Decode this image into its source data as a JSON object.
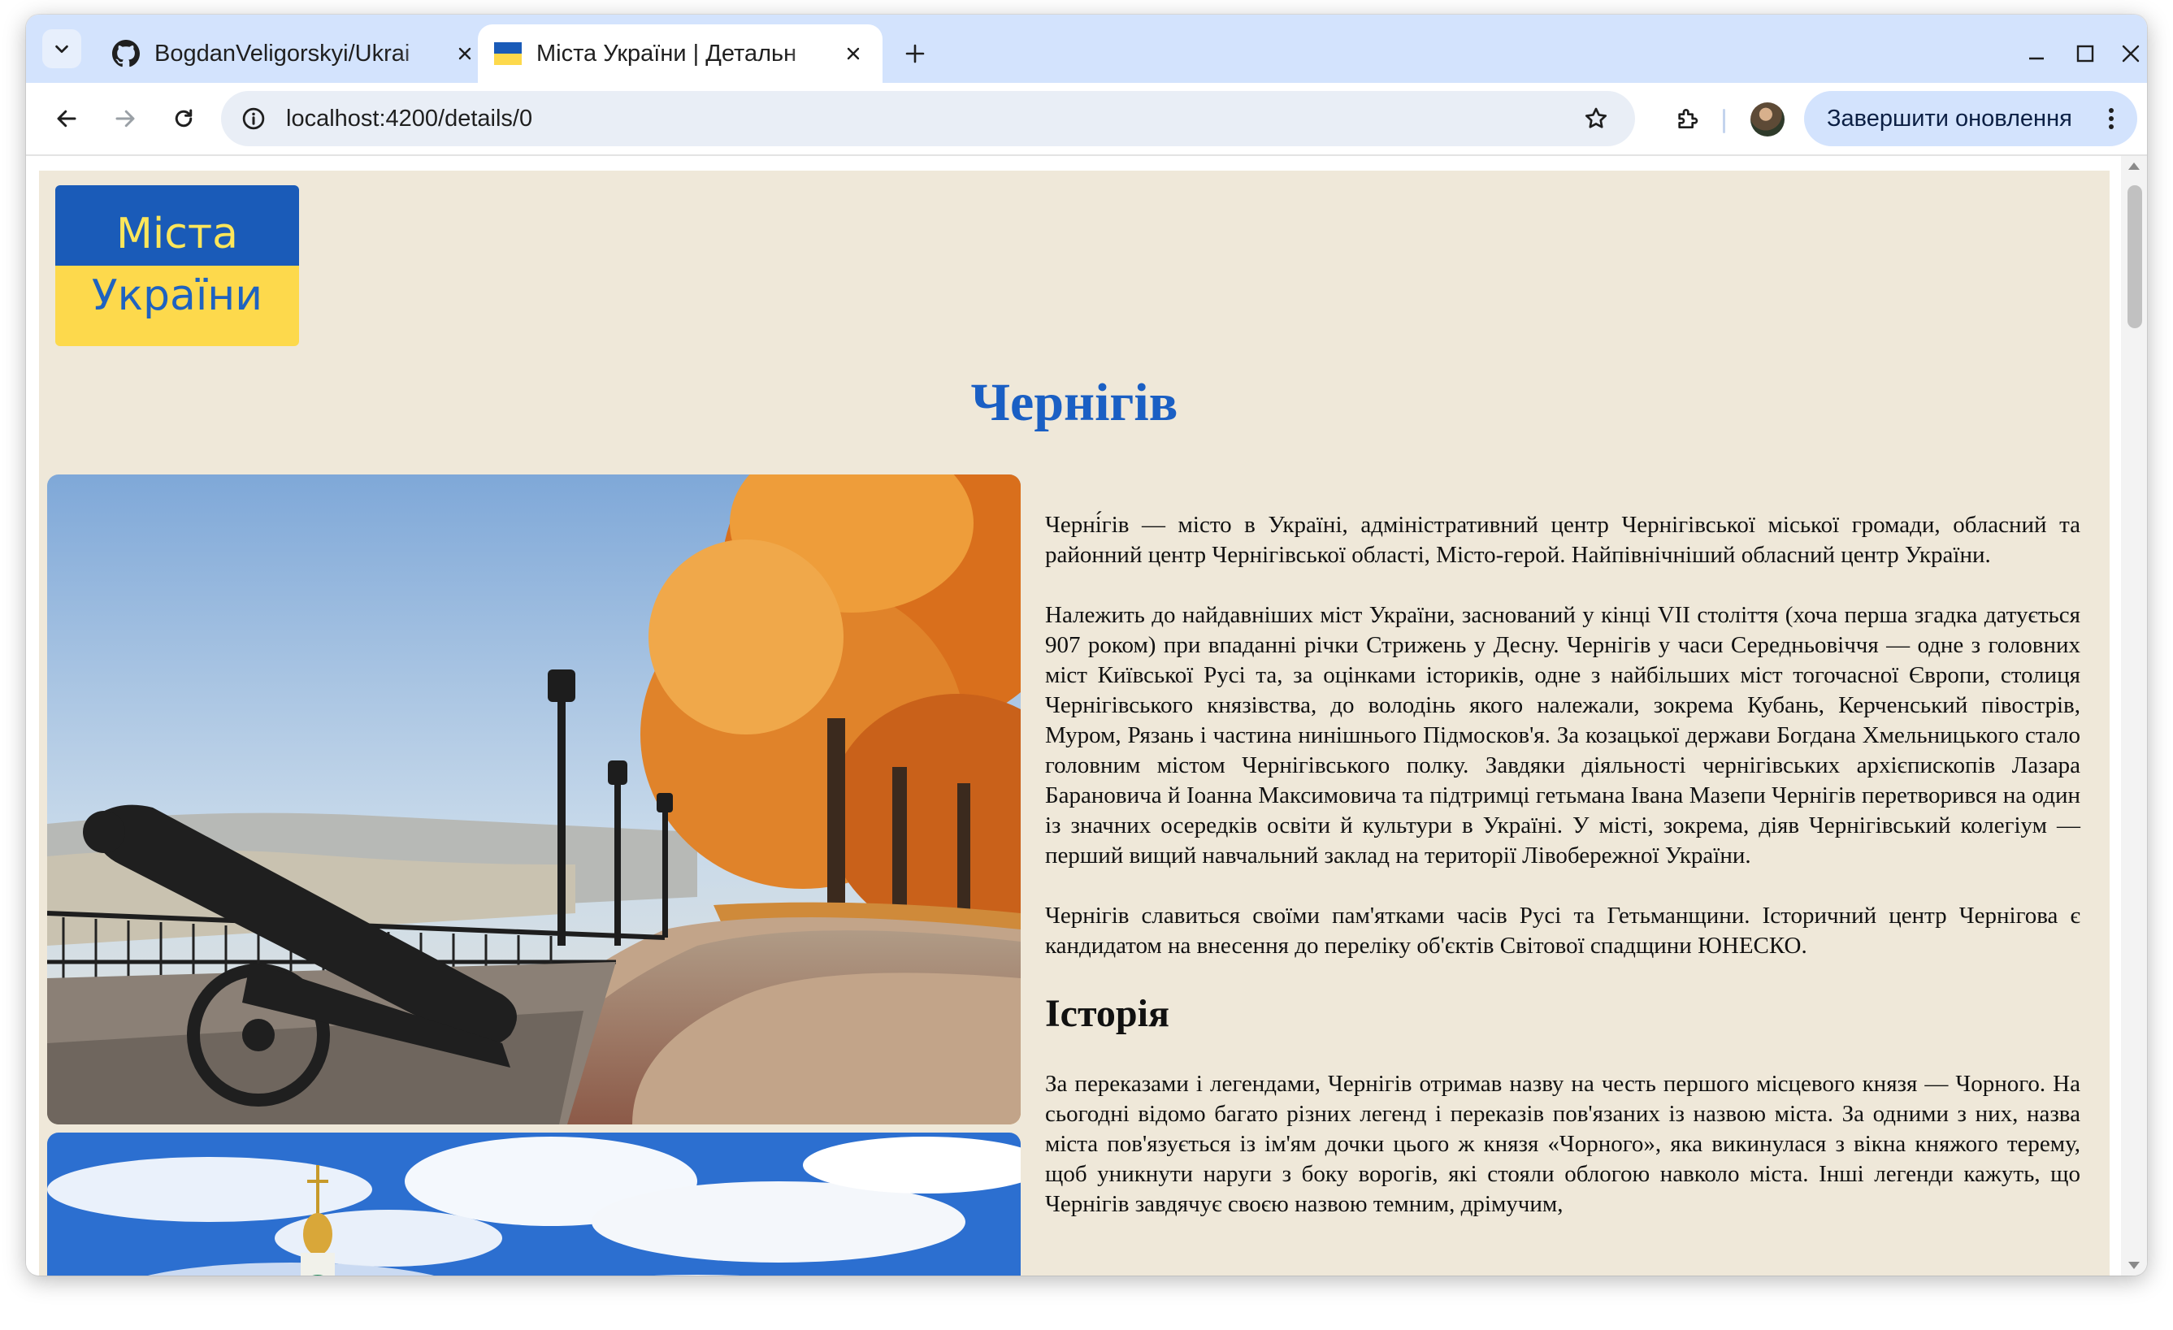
{
  "browser": {
    "tabs": [
      {
        "title": "BogdanVeligorskyi/Ukrai",
        "icon": "github-icon"
      },
      {
        "title": "Міста України | Детальн",
        "icon": "ukraine-flag-icon"
      }
    ],
    "url": "localhost:4200/details/0",
    "update_button_label": "Завершити оновлення"
  },
  "page": {
    "logo": {
      "line1": "Міста",
      "line2": "України"
    },
    "city_title": "Чернігів",
    "paragraphs": [
      "Черні́гів — місто в Україні, адміністративний центр Чернігівської міської громади, обласний та районний центр Чернігівської області, Місто-герой. Найпівнічніший обласний центр України.",
      "Належить до найдавніших міст України, заснований у кінці VII століття (хоча перша згадка датується 907 роком) при впаданні річки Стрижень у Десну. Чернігів у часи Середньовіччя — одне з головних міст Київської Русі та, за оцінками істориків, одне з найбільших міст тогочасної Європи, столиця Чернігівського князівства, до володінь якого належали, зокрема Кубань, Керченський півострів, Муром, Рязань і частина нинішнього Підмосков'я. За козацької держави Богдана Хмельницького стало головним містом Чернігівського полку. Завдяки діяльності чернігівських архієпископів Лазара Барановича й Іоанна Максимовича та підтримці гетьмана Івана Мазепи Чернігів перетворився на один із значних осередків освіти й культури в Україні. У місті, зокрема, діяв Чернігівський колегіум — перший вищий навчальний заклад на території Лівобережної України.",
      "Чернігів славиться своїми пам'ятками часів Русі та Гетьманщини. Історичний центр Чернігова є кандидатом на внесення до переліку об'єктів Світової спадщини ЮНЕСКО."
    ],
    "history_heading": "Історія",
    "history_paragraph": "За переказами і легендами, Чернігів отримав назву на честь першого місцевого князя — Чорного. На сьогодні відомо багато різних легенд і переказів пов'язаних із назвою міста. За одними з них, назва міста пов'язується із ім'ям дочки цього ж князя «Чорного», яка викинулася з вікна княжого терему, щоб уникнути наруги з боку ворогів, які стояли облогою навколо міста. Інші легенди кажуть, що Чернігів завдячує своєю назвою темним, дрімучим,"
  },
  "colors": {
    "tabstrip": "#d3e3fd",
    "page_background": "#efe8d9",
    "title_blue": "#1a5fc4",
    "flag_blue": "#1a5bb8",
    "flag_yellow": "#fdd94c"
  }
}
